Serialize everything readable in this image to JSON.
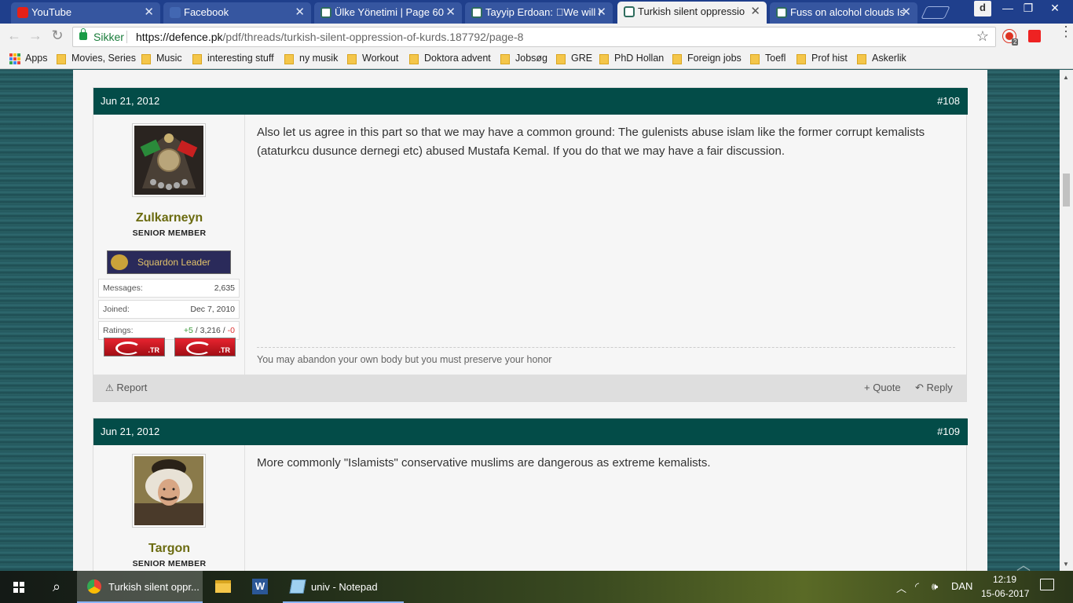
{
  "browser": {
    "tabs": [
      {
        "label": "YouTube",
        "icon": "youtube-icon",
        "active": false
      },
      {
        "label": "Facebook",
        "icon": "facebook-icon",
        "active": false
      },
      {
        "label": "Ülke Yönetimi | Page 60",
        "icon": "defence-pk-icon",
        "active": false
      },
      {
        "label": "Tayyip Erdoan: \u0000We will r",
        "icon": "defence-pk-icon",
        "active": false
      },
      {
        "label": "Turkish silent oppressio",
        "icon": "defence-pk-icon",
        "active": true
      },
      {
        "label": "Fuss on alcohol clouds Is",
        "icon": "defence-pk-icon",
        "active": false
      }
    ],
    "profile_initial": "d",
    "security_label": "Sikker",
    "url_host": "https://defence.pk",
    "url_path": "/pdf/threads/turkish-silent-oppression-of-kurds.187792/page-8",
    "extension_badge": "2",
    "bookmarks": [
      "Apps",
      "Movies, Series",
      "Music",
      "interesting stuff",
      "ny musik",
      "Workout",
      "Doktora advent",
      "Jobsøg",
      "GRE",
      "PhD Hollan",
      "Foreign jobs",
      "Toefl",
      "Prof hist",
      "Askerlik"
    ]
  },
  "posts": [
    {
      "date": "Jun 21, 2012",
      "number": "#108",
      "username": "Zulkarneyn",
      "user_title": "SENIOR MEMBER",
      "rank": "Squardon Leader",
      "stats": {
        "messages_label": "Messages:",
        "messages": "2,635",
        "joined_label": "Joined:",
        "joined": "Dec 7, 2010",
        "ratings_label": "Ratings:",
        "ratings_pos": "+5",
        "ratings_sep1": " / ",
        "ratings_total": "3,216",
        "ratings_sep2": " / ",
        "ratings_neg": "-0"
      },
      "flags": [
        ".TR",
        ".TR"
      ],
      "message": "Also let us agree in this part so that we may have a common ground: The gulenists abuse islam like the former corrupt kemalists (ataturkcu dusunce dernegi etc) abused Mustafa Kemal. If you do that we may have a fair discussion.",
      "signature": "You may abandon your own body but you must preserve your honor",
      "actions": {
        "report": "Report",
        "quote": "+ Quote",
        "reply": "Reply"
      }
    },
    {
      "date": "Jun 21, 2012",
      "number": "#109",
      "username": "Targon",
      "user_title": "SENIOR MEMBER",
      "message": "More commonly \"Islamists\" conservative muslims are dangerous as extreme kemalists."
    }
  ],
  "taskbar": {
    "items": [
      {
        "label": "Turkish silent oppr...",
        "icon": "chrome-icon",
        "active": true
      },
      {
        "label": "",
        "icon": "file-explorer-icon",
        "active": false
      },
      {
        "label": "",
        "icon": "word-icon",
        "active": false
      },
      {
        "label": "univ - Notepad",
        "icon": "notepad-icon",
        "active": false
      }
    ],
    "language": "DAN",
    "time": "12:19",
    "date": "15-06-2017"
  },
  "colors": {
    "post_header": "#034c48",
    "tab_strip": "#1f3f8c",
    "username": "#6b6b10",
    "positive": "#3a9a3a",
    "negative": "#d33"
  }
}
